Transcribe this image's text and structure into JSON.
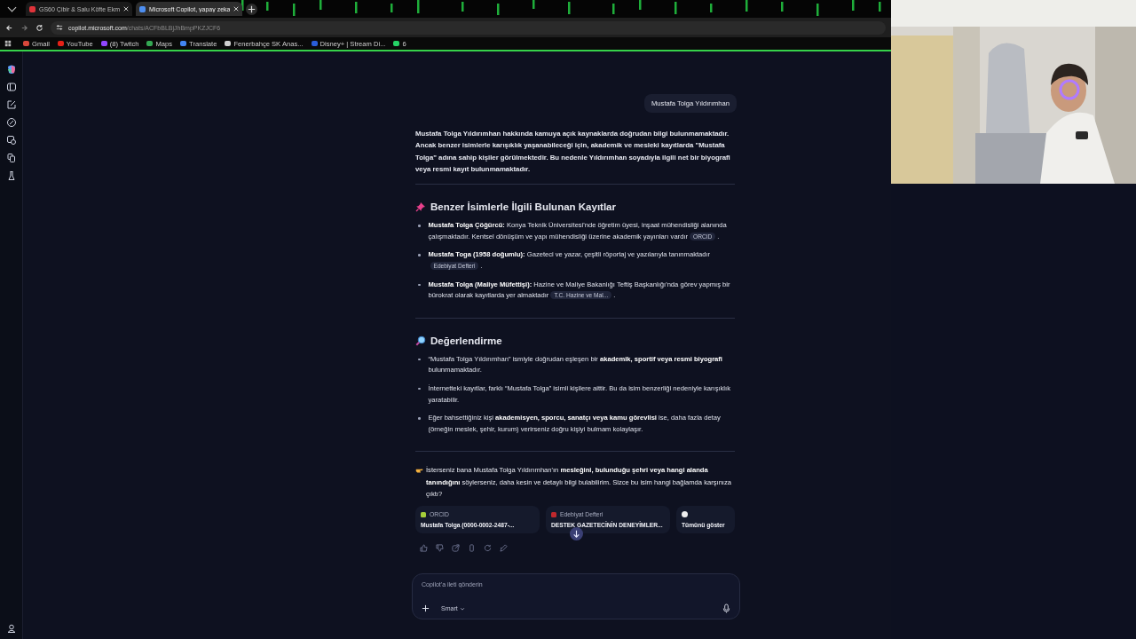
{
  "browser": {
    "tabs": [
      {
        "title": "GS60 Çibir & Salu  Köfte Ekm",
        "selected": false,
        "color": "#e0333a"
      },
      {
        "title": "Microsoft Copilot, yapay zeka",
        "selected": true,
        "color": "#4d8ef0"
      }
    ],
    "address": {
      "host": "copilot.microsoft.com",
      "path": "/chats/ACFbBLBjJhBmpPKZJCF6"
    },
    "bookmarks": [
      {
        "label": "Gmail",
        "color": "#d9483b"
      },
      {
        "label": "YouTube",
        "color": "#e62117"
      },
      {
        "label": "(8) Twitch",
        "color": "#9146ff"
      },
      {
        "label": "Maps",
        "color": "#34a853"
      },
      {
        "label": "Translate",
        "color": "#4285f4"
      },
      {
        "label": "Fenerbahçe SK Anas...",
        "color": "#cfcfcf"
      },
      {
        "label": "Disney+ | Stream Di...",
        "color": "#2a5dd8"
      },
      {
        "label": "6",
        "color": "#25d366"
      }
    ]
  },
  "chat": {
    "user_message": "Mustafa Tolga Yıldırımhan",
    "intro": "Mustafa Tolga Yıldırımhan hakkında kamuya açık kaynaklarda doğrudan bilgi bulunmamaktadır. Ancak benzer isimlerle karışıklık yaşanabileceği için, akademik ve mesleki kayıtlarda \"Mustafa Tolga\" adına sahip kişiler görülmektedir. Bu nedenle Yıldırımhan soyadıyla ilgili net bir biyografi veya resmi kayıt bulunmamaktadır.",
    "sections": [
      {
        "kind": "pin",
        "heading": "Benzer İsimlerle İlgili Bulunan Kayıtlar",
        "items": [
          {
            "text": "**Mustafa Tolga Çöğürcü:** Konya Teknik Üniversitesi'nde öğretim üyesi, inşaat mühendisliği alanında çalışmaktadır. Kentsel dönüşüm ve yapı mühendisliği üzerine akademik yayınları vardır",
            "source": "ORCID",
            "after": "."
          },
          {
            "text": "**Mustafa Toga (1958 doğumlu):** Gazeteci ve yazar, çeşitli röportaj ve yazılarıyla tanınmaktadır",
            "source": "Edebiyat Defteri",
            "after": "."
          },
          {
            "text": "**Mustafa Tolga (Maliye Müfettişi):** Hazine ve Maliye Bakanlığı Teftiş Başkanlığı'nda görev yapmış bir bürokrat olarak kayıtlarda yer almaktadır",
            "source": "T.C. Hazine ve Mal...",
            "after": "."
          }
        ]
      },
      {
        "kind": "search",
        "heading": "Değerlendirme",
        "items": [
          {
            "text": "“Mustafa Tolga Yıldırımhan” ismiyle doğrudan eşleşen bir **akademik, sportif veya resmi biyografi** bulunmamaktadır."
          },
          {
            "text": "İnternetteki kayıtlar, farklı “Mustafa Tolga” isimli kişilere aittir. Bu da isim benzerliği nedeniyle karışıklık yaratabilir."
          },
          {
            "text": "Eğer bahsettiğiniz kişi **akademisyen, sporcu, sanatçı veya kamu görevlisi** ise, daha fazla detay (örneğin meslek, şehir, kurum) verirseniz doğru kişiyi bulmam kolaylaşır."
          }
        ]
      }
    ],
    "closing": "İsterseniz bana Mustafa Tolga Yıldırımhan'ın **mesleğini, bulunduğu şehri veya hangi alanda tanındığını** söylerseniz, daha kesin ve detaylı bilgi bulabilirim. Sizce bu isim hangi bağlamda karşınıza çıktı?",
    "citations": [
      {
        "source": "ORCID",
        "title": "Mustafa Tolga (0000-0002-2487-...",
        "color": "#a6ce39"
      },
      {
        "source": "Edebiyat Defteri",
        "title": "DESTEK GAZETECİNİN DENEYİMLER...",
        "color": "#c0282d"
      }
    ],
    "show_all": "Tümünü göster"
  },
  "composer": {
    "placeholder": "Copilot'a ileti gönderin",
    "mode": "Smart"
  }
}
